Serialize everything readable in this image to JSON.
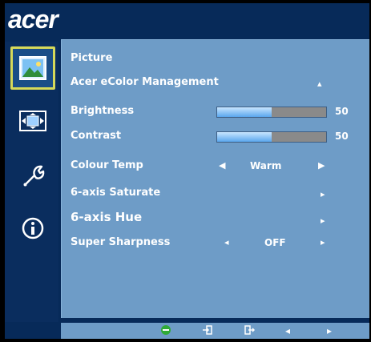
{
  "brand": {
    "logo_text": "acer"
  },
  "sidebar": {
    "items": [
      {
        "name": "picture",
        "icon": "picture-icon",
        "active": true
      },
      {
        "name": "position",
        "icon": "position-icon",
        "active": false
      },
      {
        "name": "settings",
        "icon": "wrench-icon",
        "active": false
      },
      {
        "name": "information",
        "icon": "info-icon",
        "active": false
      }
    ]
  },
  "menu": {
    "title": "Picture",
    "acer_ecolor_management": {
      "label": "Acer eColor Management"
    },
    "brightness": {
      "label": "Brightness",
      "value": "50",
      "level": 0.5
    },
    "contrast": {
      "label": "Contrast",
      "value": "50",
      "level": 0.5
    },
    "colour_temp": {
      "label": "Colour Temp",
      "value": "Warm"
    },
    "six_axis_saturate": {
      "label": "6-axis Saturate"
    },
    "six_axis_hue": {
      "label": "6-axis Hue"
    },
    "super_sharpness": {
      "label": "Super Sharpness",
      "value": "OFF"
    }
  },
  "footer": {
    "icons": [
      "ecolor-icon",
      "enter-icon",
      "exit-icon",
      "left-arrow-icon",
      "right-arrow-icon"
    ]
  },
  "colors": {
    "panel": "#6e9cc7",
    "background": "#072a59",
    "bar_fill": "#5aa7ee",
    "bar_track": "#8a8a8a",
    "active_highlight": "#d6d95a",
    "ecolor_green": "#2faa37"
  }
}
